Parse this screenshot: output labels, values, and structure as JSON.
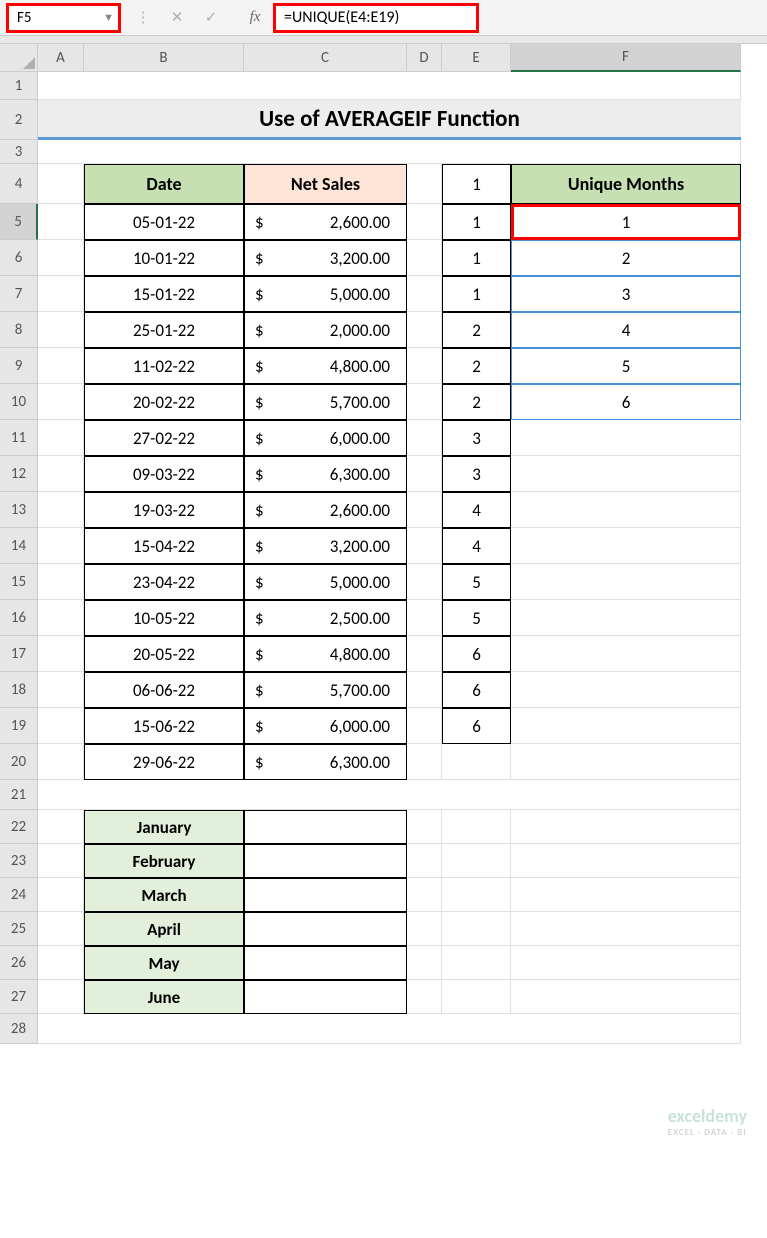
{
  "formula_bar": {
    "cell_ref": "F5",
    "formula": "=UNIQUE(E4:E19)"
  },
  "columns": [
    "A",
    "B",
    "C",
    "D",
    "E",
    "F"
  ],
  "title": "Use of AVERAGEIF Function",
  "headers": {
    "date": "Date",
    "netsales": "Net Sales",
    "unique": "Unique Months",
    "e4": "1"
  },
  "data_rows": [
    {
      "row": "5",
      "date": "05-01-22",
      "cur": "$",
      "amt": "2,600.00",
      "e": "1",
      "f": "1"
    },
    {
      "row": "6",
      "date": "10-01-22",
      "cur": "$",
      "amt": "3,200.00",
      "e": "1",
      "f": "2"
    },
    {
      "row": "7",
      "date": "15-01-22",
      "cur": "$",
      "amt": "5,000.00",
      "e": "1",
      "f": "3"
    },
    {
      "row": "8",
      "date": "25-01-22",
      "cur": "$",
      "amt": "2,000.00",
      "e": "2",
      "f": "4"
    },
    {
      "row": "9",
      "date": "11-02-22",
      "cur": "$",
      "amt": "4,800.00",
      "e": "2",
      "f": "5"
    },
    {
      "row": "10",
      "date": "20-02-22",
      "cur": "$",
      "amt": "5,700.00",
      "e": "2",
      "f": "6"
    },
    {
      "row": "11",
      "date": "27-02-22",
      "cur": "$",
      "amt": "6,000.00",
      "e": "3",
      "f": ""
    },
    {
      "row": "12",
      "date": "09-03-22",
      "cur": "$",
      "amt": "6,300.00",
      "e": "3",
      "f": ""
    },
    {
      "row": "13",
      "date": "19-03-22",
      "cur": "$",
      "amt": "2,600.00",
      "e": "4",
      "f": ""
    },
    {
      "row": "14",
      "date": "15-04-22",
      "cur": "$",
      "amt": "3,200.00",
      "e": "4",
      "f": ""
    },
    {
      "row": "15",
      "date": "23-04-22",
      "cur": "$",
      "amt": "5,000.00",
      "e": "5",
      "f": ""
    },
    {
      "row": "16",
      "date": "10-05-22",
      "cur": "$",
      "amt": "2,500.00",
      "e": "5",
      "f": ""
    },
    {
      "row": "17",
      "date": "20-05-22",
      "cur": "$",
      "amt": "4,800.00",
      "e": "6",
      "f": ""
    },
    {
      "row": "18",
      "date": "06-06-22",
      "cur": "$",
      "amt": "5,700.00",
      "e": "6",
      "f": ""
    },
    {
      "row": "19",
      "date": "15-06-22",
      "cur": "$",
      "amt": "6,000.00",
      "e": "6",
      "f": ""
    }
  ],
  "row20": {
    "row": "20",
    "date": "29-06-22",
    "cur": "$",
    "amt": "6,300.00"
  },
  "months": [
    {
      "row": "22",
      "name": "January"
    },
    {
      "row": "23",
      "name": "February"
    },
    {
      "row": "24",
      "name": "March"
    },
    {
      "row": "25",
      "name": "April"
    },
    {
      "row": "26",
      "name": "May"
    },
    {
      "row": "27",
      "name": "June"
    }
  ],
  "watermark": {
    "brand": "exceldemy",
    "tag": "EXCEL · DATA · BI"
  }
}
